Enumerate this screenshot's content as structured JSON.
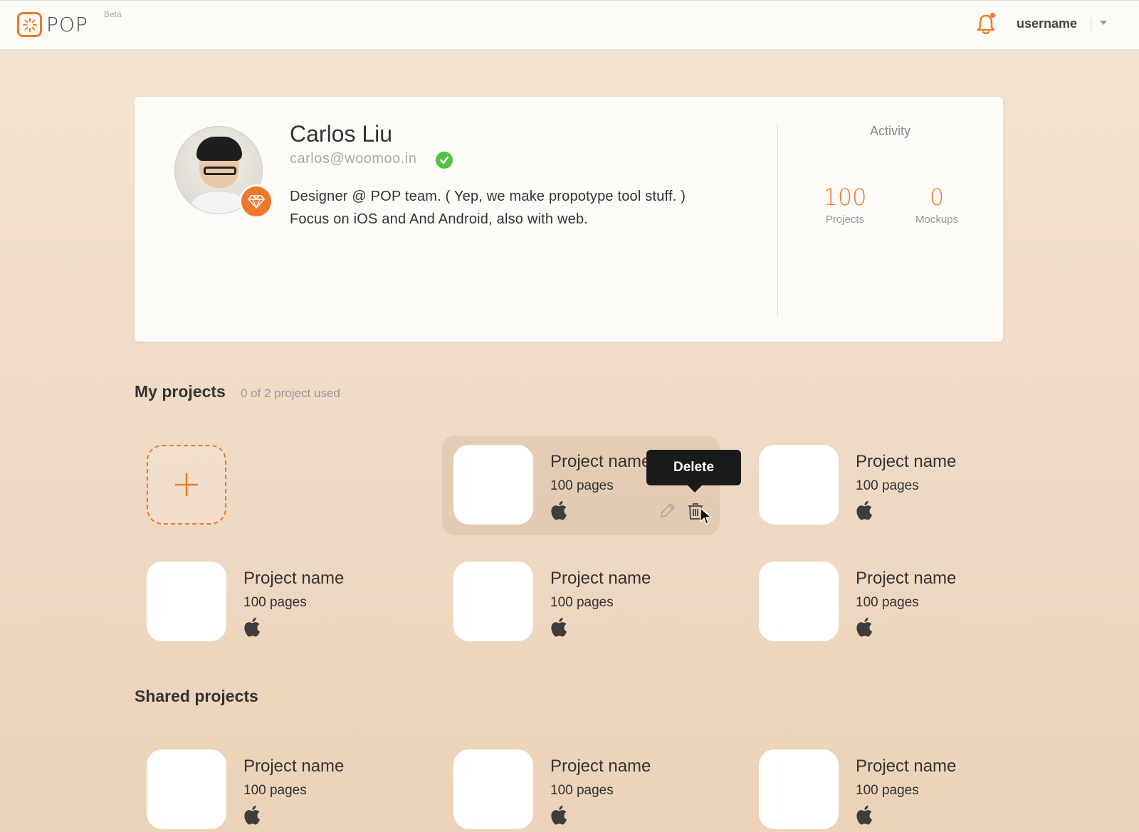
{
  "header": {
    "logo_text": "POP",
    "beta_label": "Beta",
    "username": "username"
  },
  "profile": {
    "name": "Carlos Liu",
    "email": "carlos@woomoo.in",
    "bio_line1": "Designer @ POP team. ( Yep, we make propotype tool stuff. )",
    "bio_line2": "Focus on iOS and And Android, also with web."
  },
  "activity": {
    "title": "Activity",
    "projects_count": "100",
    "projects_label": "Projects",
    "mockups_count": "0",
    "mockups_label": "Mockups"
  },
  "my_projects": {
    "title": "My projects",
    "usage": "0 of 2 project used",
    "tooltip": "Delete",
    "items": [
      {
        "name": "Project name",
        "pages": "100 pages",
        "platform": "apple-icon"
      },
      {
        "name": "Project name",
        "pages": "100 pages",
        "platform": "apple-icon"
      },
      {
        "name": "Project name",
        "pages": "100 pages",
        "platform": "apple-icon"
      },
      {
        "name": "Project name",
        "pages": "100 pages",
        "platform": "apple-icon"
      },
      {
        "name": "Project name",
        "pages": "100 pages",
        "platform": "apple-icon"
      }
    ]
  },
  "shared_projects": {
    "title": "Shared projects",
    "items": [
      {
        "name": "Project name",
        "pages": "100 pages",
        "platform": "apple-icon"
      },
      {
        "name": "Project name",
        "pages": "100 pages",
        "platform": "apple-icon"
      },
      {
        "name": "Project name",
        "pages": "100 pages",
        "platform": "apple-icon"
      }
    ]
  },
  "colors": {
    "accent": "#f0782a",
    "verified": "#56c046",
    "tooltip_bg": "#1a1a1a"
  }
}
